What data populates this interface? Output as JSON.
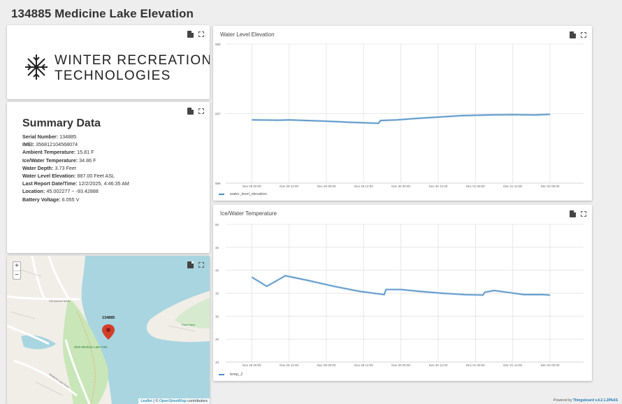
{
  "page": {
    "title": "134885 Medicine Lake Elevation"
  },
  "logo": {
    "line1": "WINTER RECREATION",
    "line2": "TECHNOLOGIES"
  },
  "summary": {
    "heading": "Summary Data",
    "rows": [
      {
        "label": "Serial Number:",
        "value": " 134885"
      },
      {
        "label": "IMEI:",
        "value": " 356812104568074"
      },
      {
        "label": "Ambient Temperature:",
        "value": " 15.81 F"
      },
      {
        "label": "Ice/Water Temperature:",
        "value": " 34.86 F"
      },
      {
        "label": "Water Depth:",
        "value": " 3.73 Feet"
      },
      {
        "label": "Water Level Elevation:",
        "value": " 887.00 Feet ASL"
      },
      {
        "label": "Last Report Date/Time:",
        "value": " 12/2/2025, 4:46:35 AM"
      },
      {
        "label": "Location:",
        "value": " 45.002277 ~ -93.42888"
      },
      {
        "label": "Battery Voltage:",
        "value": " 6.055 V"
      }
    ]
  },
  "map": {
    "zoom_in": "+",
    "zoom_out": "−",
    "marker_label": "134885",
    "attribution_leaflet": "Leaflet",
    "attribution_sep": " | © ",
    "attribution_osm": "OpenStreetMap",
    "attribution_tail": " contributors",
    "place_labels": [
      "Old Avenue North",
      "West Medicine Lake Park",
      "Park Place",
      "Medicine Lake Drive"
    ]
  },
  "footer": {
    "prefix": "Powered by ",
    "brand": "Thingsboard v.4.2.1.2PAAS"
  },
  "chart_data": [
    {
      "type": "line",
      "title": "Water Level Elevation",
      "x": [
        "Nov 28 00:00",
        "Nov 28 12:00",
        "Nov 29 00:00",
        "Nov 29 12:00",
        "Nov 30 00:00",
        "Nov 30 12:00",
        "Dec 01 00:00",
        "Dec 01 12:00",
        "Dec 02 00:00"
      ],
      "ylim": [
        886,
        888
      ],
      "yticks": [
        "888",
        "887",
        "886"
      ],
      "series": [
        {
          "name": "water_level_elevation",
          "color": "#4a8bc2",
          "points": [
            [
              0,
              886.91
            ],
            [
              0.7,
              886.905
            ],
            [
              1.0,
              886.91
            ],
            [
              1.5,
              886.9
            ],
            [
              2.0,
              886.89
            ],
            [
              2.6,
              886.875
            ],
            [
              3.4,
              886.86
            ],
            [
              3.45,
              886.9
            ],
            [
              3.9,
              886.91
            ],
            [
              4.4,
              886.93
            ],
            [
              5.0,
              886.95
            ],
            [
              5.6,
              886.97
            ],
            [
              6.3,
              886.98
            ],
            [
              7.0,
              886.985
            ],
            [
              7.6,
              886.98
            ],
            [
              8.0,
              886.99
            ]
          ]
        }
      ],
      "legend": "bottom-left",
      "grid": true
    },
    {
      "type": "line",
      "title": "Ice/Water Temperature",
      "x": [
        "Nov 28 00:00",
        "Nov 28 12:00",
        "Nov 29 00:00",
        "Nov 29 12:00",
        "Nov 30 00:00",
        "Nov 30 12:00",
        "Dec 01 00:00",
        "Dec 01 12:00",
        "Dec 02 00:00"
      ],
      "ylim": [
        20,
        50
      ],
      "yticks": [
        "50",
        "45",
        "40",
        "35",
        "30",
        "25",
        "20"
      ],
      "series": [
        {
          "name": "temp_2",
          "color": "#4a8bc2",
          "points": [
            [
              0,
              38.5
            ],
            [
              0.4,
              36.5
            ],
            [
              0.9,
              38.8
            ],
            [
              1.5,
              37.8
            ],
            [
              2.2,
              36.5
            ],
            [
              2.9,
              35.4
            ],
            [
              3.55,
              34.7
            ],
            [
              3.6,
              35.8
            ],
            [
              4.0,
              35.8
            ],
            [
              4.5,
              35.4
            ],
            [
              5.1,
              35.0
            ],
            [
              5.7,
              34.7
            ],
            [
              6.2,
              34.6
            ],
            [
              6.25,
              35.2
            ],
            [
              6.5,
              35.6
            ],
            [
              6.85,
              35.2
            ],
            [
              7.3,
              34.7
            ],
            [
              7.8,
              34.7
            ],
            [
              8.0,
              34.6
            ]
          ]
        }
      ],
      "legend": "bottom-left",
      "grid": true
    }
  ]
}
